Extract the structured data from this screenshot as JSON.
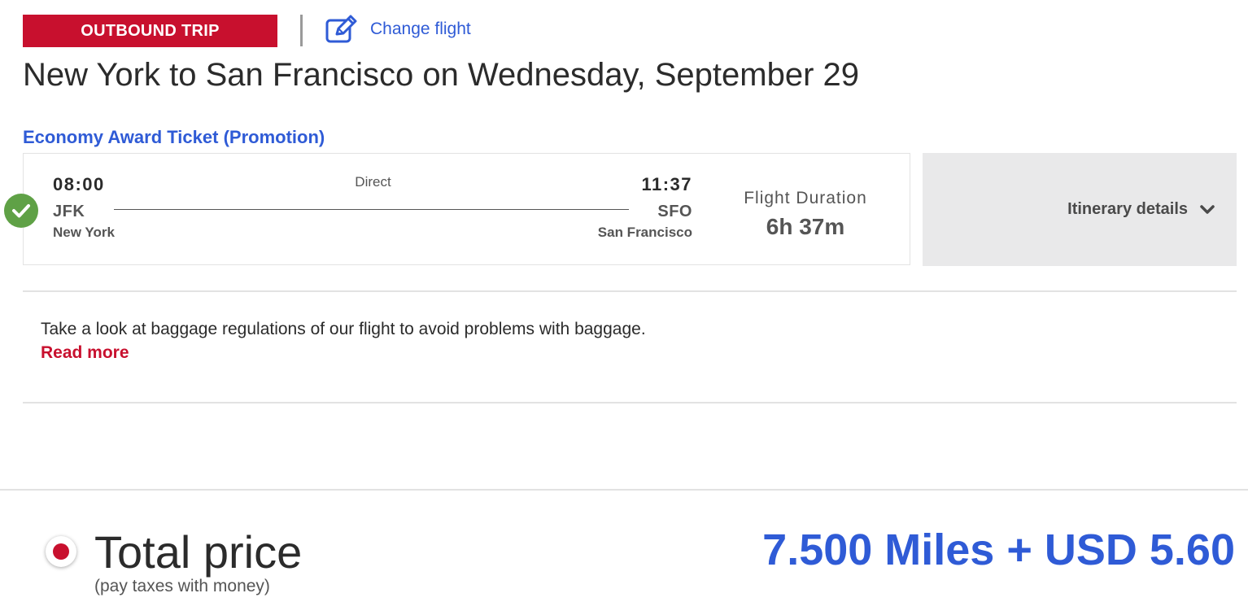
{
  "header": {
    "trip_badge": "OUTBOUND TRIP",
    "change_flight_label": "Change flight",
    "title": "New York to San Francisco on Wednesday, September 29"
  },
  "fare": {
    "label": "Economy Award Ticket (Promotion)"
  },
  "flight": {
    "departure_time": "08:00",
    "departure_code": "JFK",
    "departure_city": "New York",
    "stops_label": "Direct",
    "arrival_time": "11:37",
    "arrival_code": "SFO",
    "arrival_city": "San Francisco",
    "duration_label": "Flight Duration",
    "duration_value": "6h 37m",
    "selected": true
  },
  "itinerary": {
    "label": "Itinerary details"
  },
  "baggage": {
    "text": "Take a look at baggage regulations of our flight to avoid problems with baggage.",
    "read_more": "Read more"
  },
  "price": {
    "label": "Total price",
    "sub_label": "(pay taxes with money)",
    "value": "7.500 Miles + USD 5.60",
    "selected": true
  },
  "colors": {
    "brand_red": "#c8102e",
    "link_blue": "#2f5bd6",
    "success_green": "#5fa146",
    "panel_gray": "#e9e9ea"
  },
  "icons": {
    "change_flight": "edit-icon",
    "selected_flight": "check-circle-icon",
    "itinerary_toggle": "chevron-down-icon"
  }
}
